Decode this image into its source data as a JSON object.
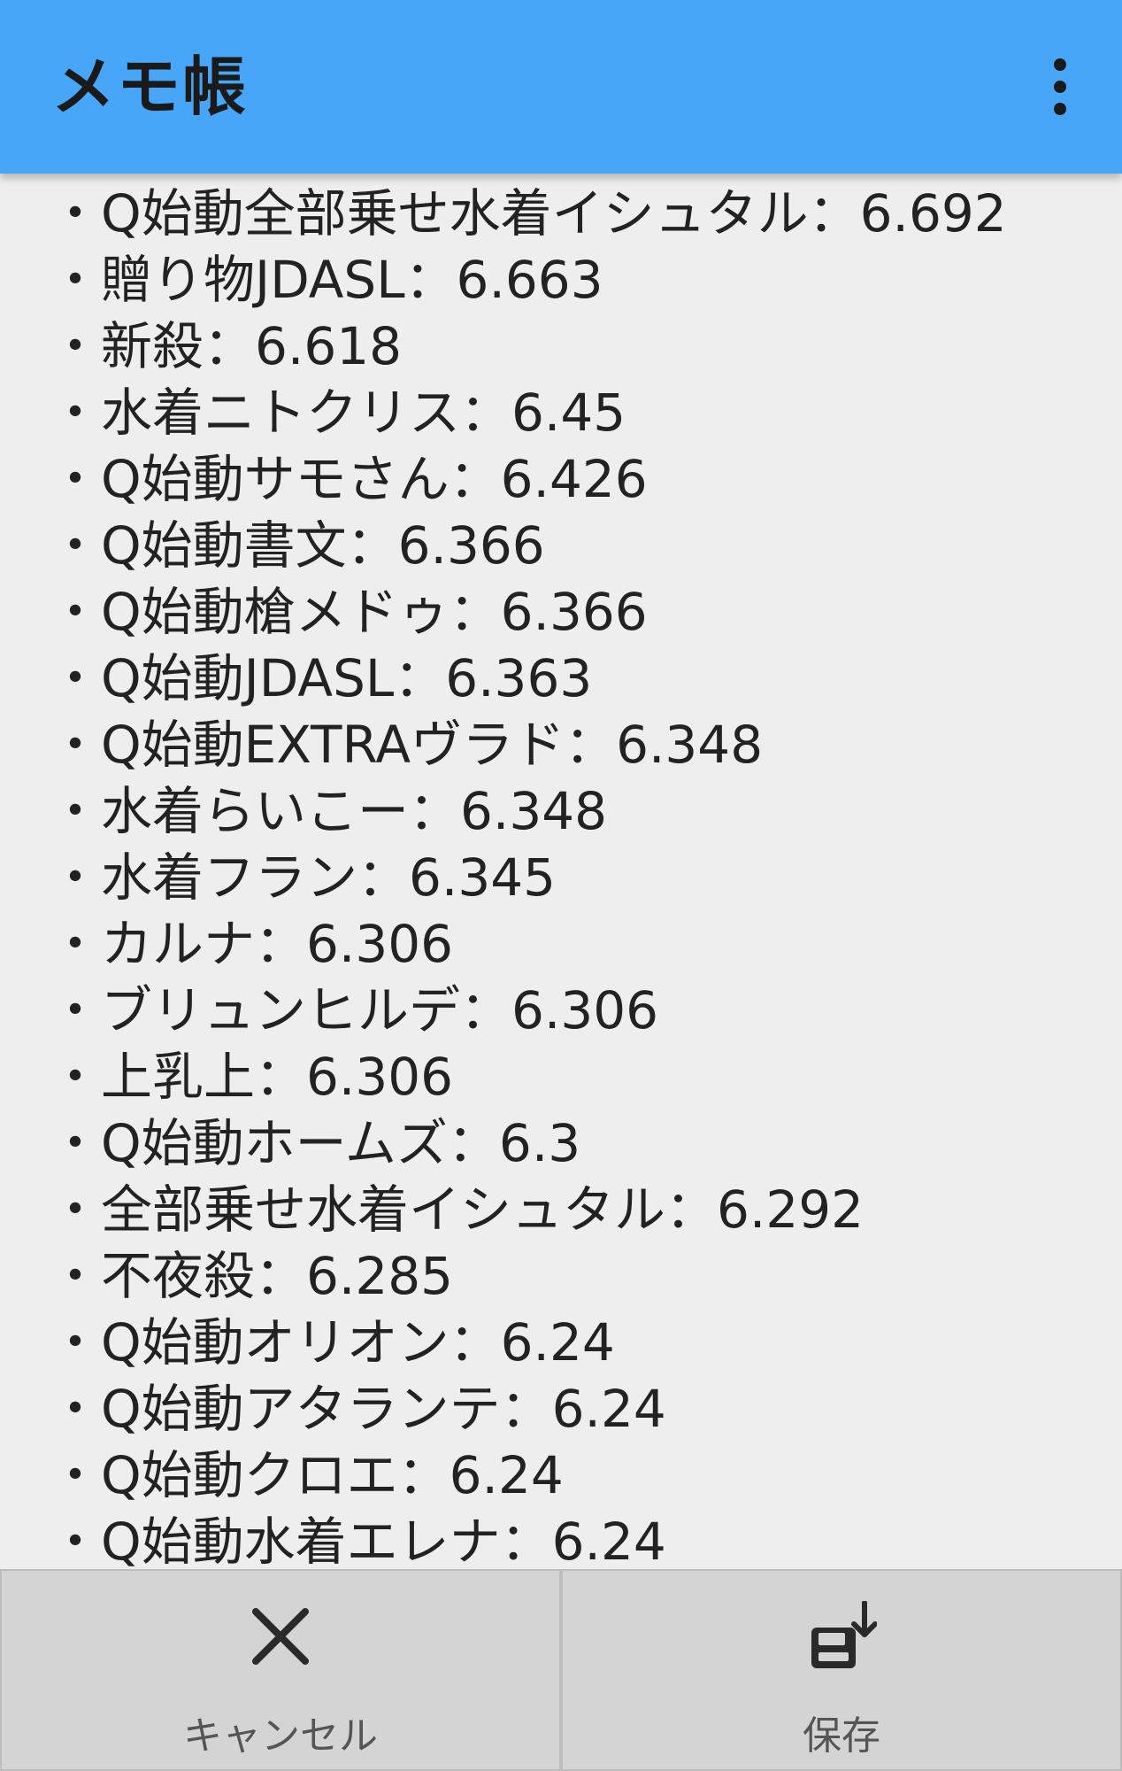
{
  "appbar": {
    "title": "メモ帳",
    "menu_icon": "more-vertical-icon"
  },
  "memo": {
    "lines": [
      "・Q始動全部乗せ水着イシュタル：6.692",
      "・贈り物JDASL：6.663",
      "・新殺：6.618",
      "・水着ニトクリス：6.45",
      "・Q始動サモさん：6.426",
      "・Q始動書文：6.366",
      "・Q始動槍メドゥ：6.366",
      "・Q始動JDASL：6.363",
      "・Q始動EXTRAヴラド：6.348",
      "・水着らいこー：6.348",
      "・水着フラン：6.345",
      "・カルナ：6.306",
      "・ブリュンヒルデ：6.306",
      "・上乳上：6.306",
      "・Q始動ホームズ：6.3",
      "・全部乗せ水着イシュタル：6.292",
      "・不夜殺：6.285",
      "・Q始動オリオン：6.24",
      "・Q始動アタランテ：6.24",
      "・Q始動クロエ：6.24",
      "・Q始動水着エレナ：6.24"
    ]
  },
  "bottom_bar": {
    "cancel": {
      "label": "キャンセル",
      "icon": "close-icon"
    },
    "save": {
      "label": "保存",
      "icon": "save-icon"
    }
  },
  "colors": {
    "appbar": "#48a6f8",
    "background": "#eeeeee",
    "button_bar": "#d4d4d4"
  }
}
